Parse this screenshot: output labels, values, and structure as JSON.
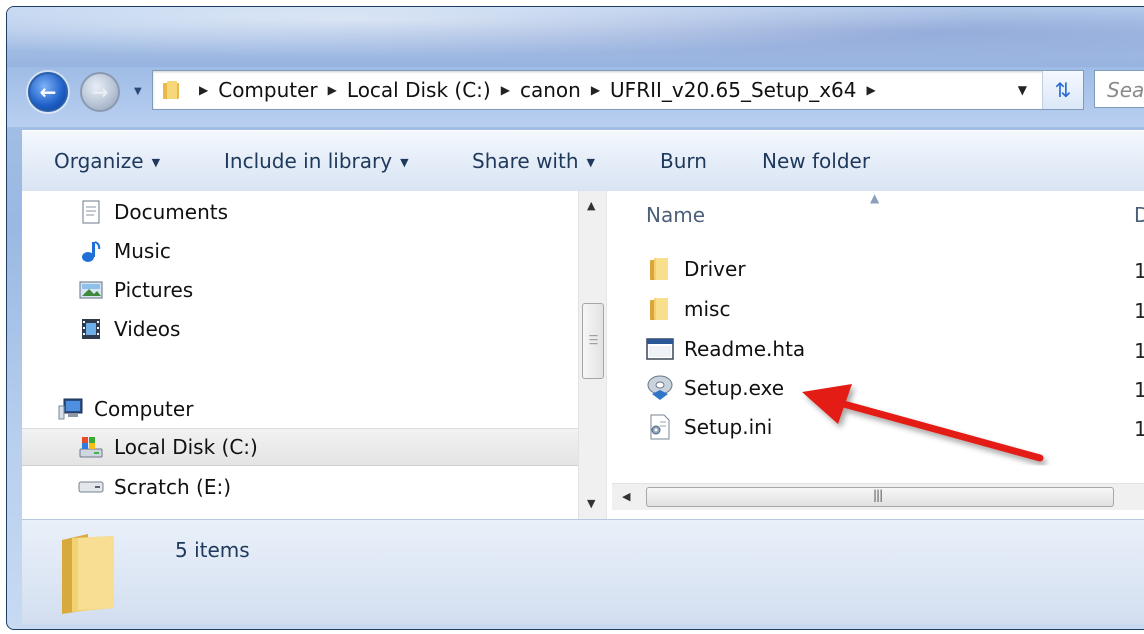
{
  "colors": {
    "accent": "#1d5fc8",
    "annotation_arrow": "#e41b17"
  },
  "nav": {
    "back_icon": "back-arrow-icon",
    "forward_icon": "forward-arrow-icon",
    "breadcrumbs": [
      "Computer",
      "Local Disk (C:)",
      "canon",
      "UFRII_v20.65_Setup_x64"
    ],
    "search_placeholder": "Sea"
  },
  "toolbar": {
    "organize": "Organize",
    "include_in_library": "Include in library",
    "share_with": "Share with",
    "burn": "Burn",
    "new_folder": "New folder"
  },
  "navpane": {
    "items": [
      {
        "label": "Documents",
        "icon": "documents-icon"
      },
      {
        "label": "Music",
        "icon": "music-icon"
      },
      {
        "label": "Pictures",
        "icon": "pictures-icon"
      },
      {
        "label": "Videos",
        "icon": "videos-icon"
      },
      {
        "label": "Computer",
        "icon": "computer-icon"
      },
      {
        "label": "Local Disk (C:)",
        "icon": "local-disk-icon",
        "selected": true
      },
      {
        "label": "Scratch (E:)",
        "icon": "drive-icon"
      }
    ]
  },
  "filelist": {
    "columns": {
      "name": "Name",
      "date": "D"
    },
    "files": [
      {
        "name": "Driver",
        "icon": "folder-icon",
        "date": "1"
      },
      {
        "name": "misc",
        "icon": "folder-icon",
        "date": "1"
      },
      {
        "name": "Readme.hta",
        "icon": "hta-file-icon",
        "date": "1"
      },
      {
        "name": "Setup.exe",
        "icon": "setup-exe-icon",
        "date": "1"
      },
      {
        "name": "Setup.ini",
        "icon": "ini-file-icon",
        "date": "1"
      }
    ]
  },
  "status": {
    "item_count": "5 items"
  }
}
